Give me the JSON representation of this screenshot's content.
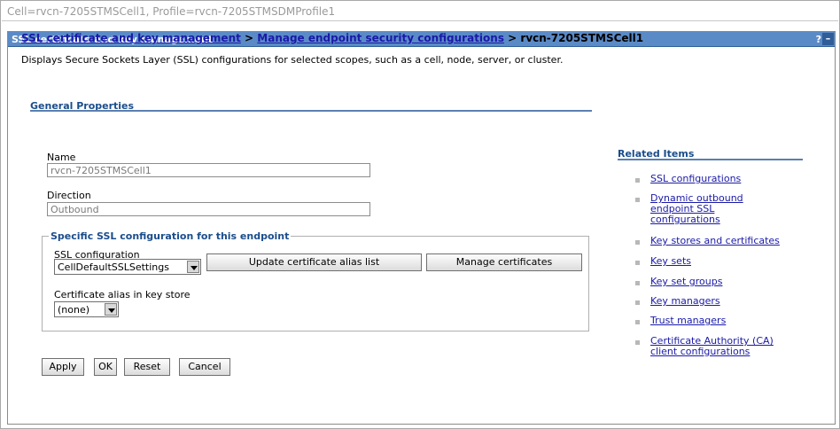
{
  "cell_bar": {
    "text": "Cell=rvcn-7205STMSCell1, Profile=rvcn-7205STMSDMProfile1"
  },
  "panel": {
    "title": "SSL certificate and key management",
    "help": "?",
    "minimize": "–"
  },
  "breadcrumb": {
    "link1": "SSL certificate and key management",
    "sep1": " > ",
    "link2": "Manage endpoint security configurations",
    "sep2": " > ",
    "current": "rvcn-7205STMSCell1"
  },
  "description": "Displays Secure Sockets Layer (SSL) configurations for selected scopes, such as a cell, node, server, or cluster.",
  "general_properties": {
    "title": "General Properties",
    "name_label": "Name",
    "name_value": "rvcn-7205STMSCell1",
    "direction_label": "Direction",
    "direction_value": "Outbound"
  },
  "specific_ssl": {
    "legend": "Specific SSL configuration for this endpoint",
    "ssl_config_label": "SSL configuration",
    "ssl_config_value": "CellDefaultSSLSettings",
    "update_button": "Update certificate alias list",
    "manage_button": "Manage certificates",
    "alias_label": "Certificate alias in key store",
    "alias_value": "(none)"
  },
  "actions": {
    "apply": "Apply",
    "ok": "OK",
    "reset": "Reset",
    "cancel": "Cancel"
  },
  "related_items": {
    "title": "Related Items",
    "items": [
      {
        "lines": [
          "SSL configurations"
        ]
      },
      {
        "lines": [
          "Dynamic outbound",
          "endpoint SSL",
          "configurations"
        ]
      },
      {
        "lines": [
          "Key stores and certificates"
        ]
      },
      {
        "lines": [
          "Key sets"
        ]
      },
      {
        "lines": [
          "Key set groups"
        ]
      },
      {
        "lines": [
          "Key managers"
        ]
      },
      {
        "lines": [
          "Trust managers"
        ]
      },
      {
        "lines": [
          "Certificate Authority (CA)",
          "client configurations"
        ]
      }
    ]
  }
}
